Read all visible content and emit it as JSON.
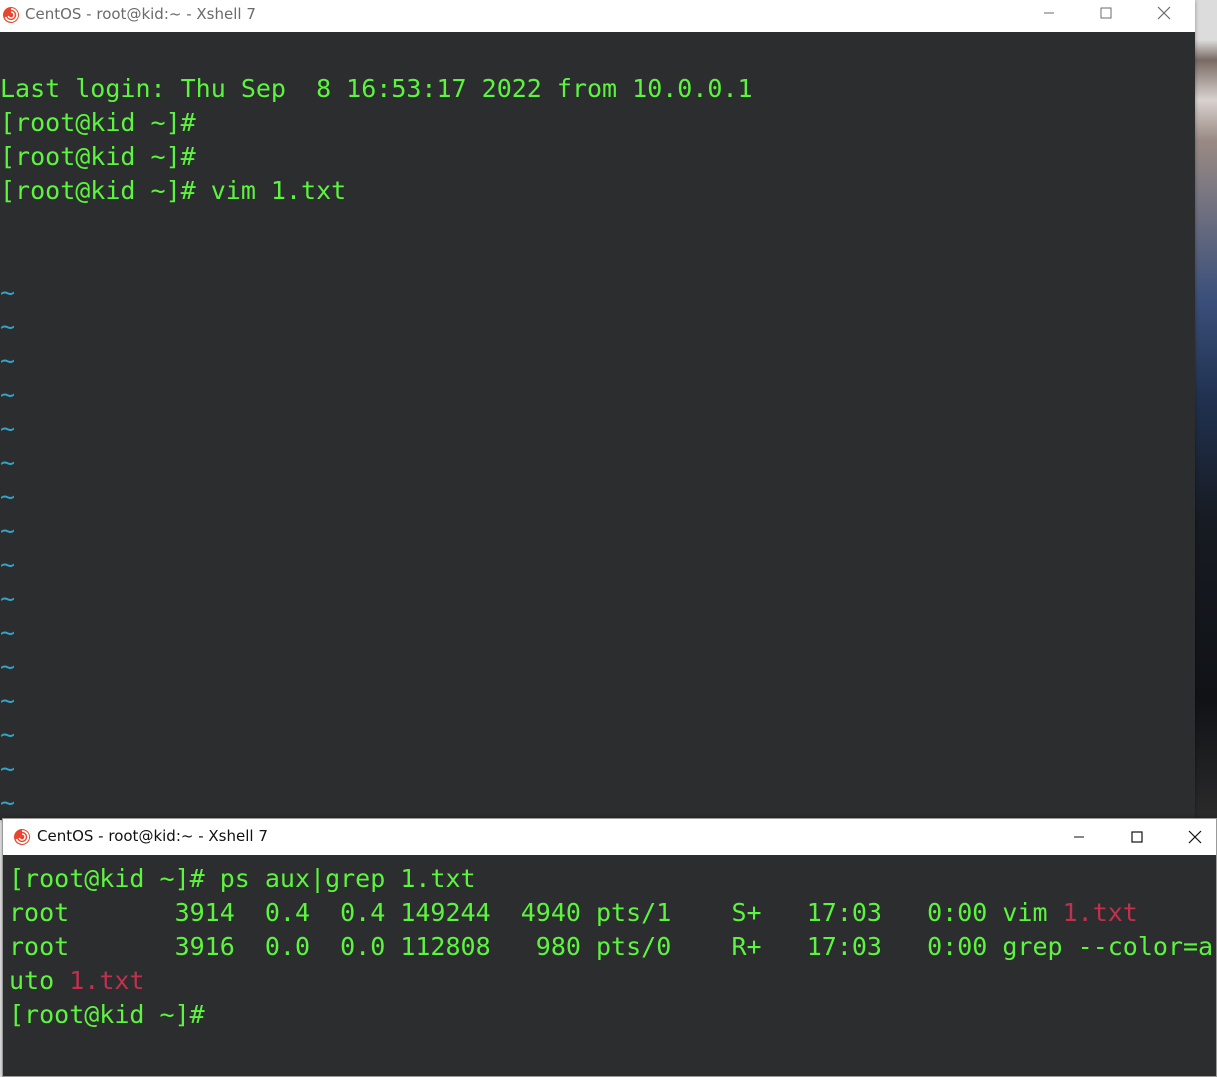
{
  "windows": [
    {
      "title": "CentOS - root@kid:~ - Xshell 7",
      "lines": [
        "Last login: Thu Sep  8 16:53:17 2022 from 10.0.0.1",
        "[root@kid ~]#",
        "[root@kid ~]#",
        "[root@kid ~]# vim 1.txt"
      ],
      "vim_empty_marker": "~",
      "vim_empty_line_count": 16
    },
    {
      "title": "CentOS - root@kid:~ - Xshell 7",
      "prompt_cmd": "[root@kid ~]# ps aux|grep 1.txt",
      "ps_rows": [
        {
          "text": "root       3914  0.4  0.4 149244  4940 pts/1    S+   17:03   0:00 vim ",
          "match": "1.txt"
        },
        {
          "text": "root       3916  0.0  0.0 112808   980 pts/0    R+   17:03   0:00 grep --color=a"
        }
      ],
      "wrap_text": "uto ",
      "wrap_match": "1.txt",
      "last_prompt": "[root@kid ~]#"
    }
  ],
  "colors": {
    "terminal_bg": "#2c2d2f",
    "terminal_fg": "#5cf53d",
    "vim_tilde": "#2ea6cc",
    "grep_match": "#c2304e",
    "titlebar_bg": "#ffffff"
  },
  "icons": {
    "app": "xshell-logo-icon",
    "minimize": "minimize-icon",
    "maximize": "maximize-icon",
    "close": "close-icon"
  }
}
